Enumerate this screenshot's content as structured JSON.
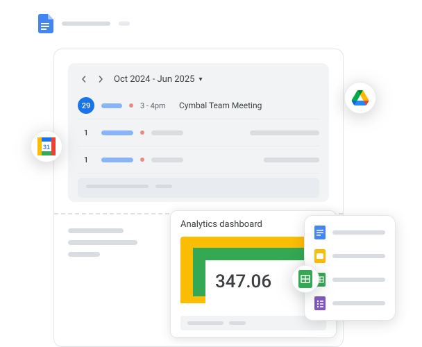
{
  "calendar": {
    "range_label": "Oct 2024 - Jun 2025",
    "events": [
      {
        "date": "29",
        "highlighted": true,
        "time": "3 - 4pm",
        "title": "Cymbal Team Meeting"
      },
      {
        "date": "1",
        "highlighted": false,
        "time": "",
        "title": ""
      },
      {
        "date": "1",
        "highlighted": false,
        "time": "",
        "title": ""
      }
    ]
  },
  "analytics": {
    "title": "Analytics dashboard",
    "metric": "347.06",
    "colors": {
      "outer": "#fbbc04",
      "mid": "#34a853",
      "inner": "#ffffff"
    }
  },
  "icons": {
    "docs": "docs-icon",
    "calendar": "calendar-icon",
    "drive": "drive-icon",
    "sheets": "sheets-icon",
    "slides": "slides-icon",
    "forms": "forms-icon"
  },
  "chart_data": {
    "type": "table",
    "title": "Analytics dashboard",
    "values": [
      347.06
    ]
  }
}
